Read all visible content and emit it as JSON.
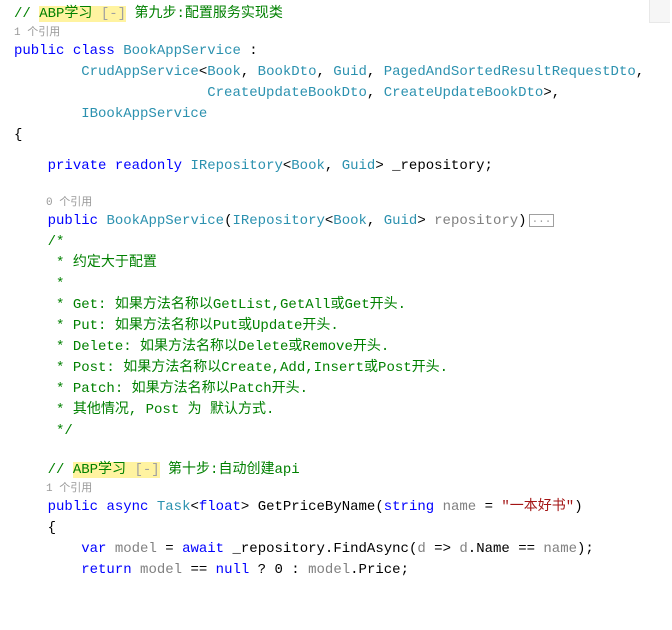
{
  "topcomment": {
    "prefix": "// ",
    "tag": "ABP学习",
    "toggle": " [-]",
    "rest": " 第九步:配置服务实现类"
  },
  "cl1": "1 个引用",
  "l1_public": "public",
  "l1_class": "class",
  "l1_name": "BookAppService",
  "l1_colon": " :",
  "l2_base": "CrudAppService",
  "l2_gen1": "Book",
  "l2_gen2": "BookDto",
  "l2_gen3": "Guid",
  "l2_gen4": "PagedAndSortedResultRequestDto",
  "l3_gen5": "CreateUpdateBookDto",
  "l3_gen6": "CreateUpdateBookDto",
  "l4_iface": "IBookAppService",
  "l5_open": "{",
  "l6_private": "private",
  "l6_readonly": "readonly",
  "l6_irepo": "IRepository",
  "l6_book": "Book",
  "l6_guid": "Guid",
  "l6_field": "_repository",
  "cl2": "0 个引用",
  "l7_public": "public",
  "l7_ctor": "BookAppService",
  "l7_irepo": "IRepository",
  "l7_book": "Book",
  "l7_guid": "Guid",
  "l7_param": "repository",
  "l7_fold": "...",
  "cblock": {
    "open": "/*",
    "c1": " * 约定大于配置",
    "c2": " *",
    "c3": " * Get: 如果方法名称以GetList,GetAll或Get开头.",
    "c4": " * Put: 如果方法名称以Put或Update开头.",
    "c5": " * Delete: 如果方法名称以Delete或Remove开头.",
    "c6": " * Post: 如果方法名称以Create,Add,Insert或Post开头.",
    "c7": " * Patch: 如果方法名称以Patch开头.",
    "c8": " * 其他情况, Post 为 默认方式.",
    "close": " */"
  },
  "botcomment": {
    "prefix": "// ",
    "tag": "ABP学习",
    "toggle": " [-]",
    "rest": " 第十步:自动创建api"
  },
  "cl3": "1 个引用",
  "m_public": "public",
  "m_async": "async",
  "m_task": "Task",
  "m_float": "float",
  "m_name": "GetPriceByName",
  "m_string": "string",
  "m_param": "name",
  "m_eq": " = ",
  "m_default": "\"一本好书\"",
  "m_open": "{",
  "b_var": "var",
  "b_model": "model",
  "b_await": "await",
  "b_repo": "_repository",
  "b_find": "FindAsync",
  "b_lamb_d1": "d",
  "b_lamb_arrow": " => ",
  "b_lamb_d2": "d",
  "b_prop_name": "Name",
  "b_eq": " == ",
  "b_namep": "name",
  "r_return": "return",
  "r_model": "model",
  "r_eq": " == ",
  "r_null": "null",
  "r_q": " ? ",
  "r_zero": "0",
  "r_colon": " : ",
  "r_model2": "model",
  "r_price": "Price"
}
